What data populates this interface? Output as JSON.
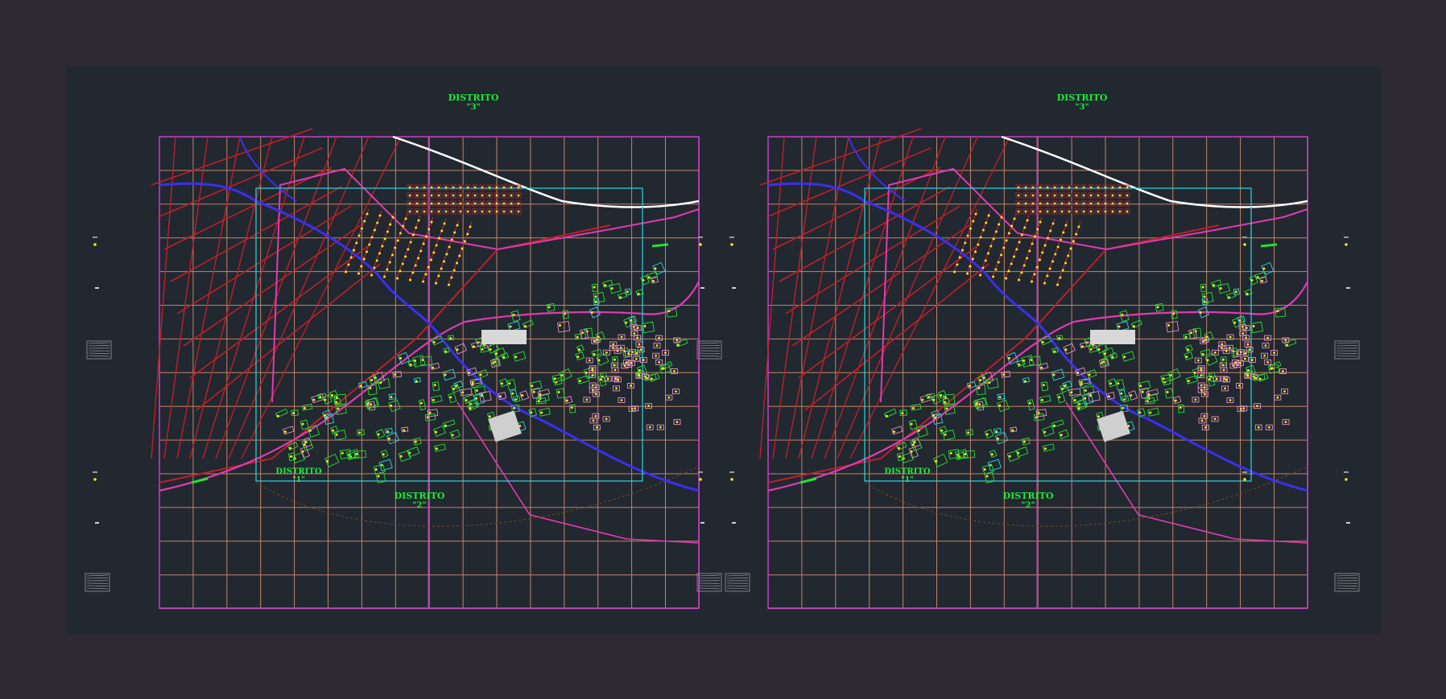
{
  "colors": {
    "background": "#2e2a31",
    "sheet": "#212830",
    "grid": "#c4846a",
    "frame": "#c03cc0",
    "road_red": "#c01f2a",
    "road_magenta": "#e23ab0",
    "river": "#3a2ff0",
    "lots_green": "#26e030",
    "lots_cyan": "#2ad8e0",
    "dots_yellow": "#f2e81a",
    "parcels_pink": "#e890c8",
    "district_label": "#22e83a",
    "highway": "#ffffff"
  },
  "sheets": [
    {
      "name": "left",
      "title_line1": "DISTRITO",
      "title_line2": "\"3\"",
      "bottom_line1": "DISTRITO",
      "bottom_line2": "\"2\"",
      "small_line1": "DISTRITO",
      "small_line2": "\"1\""
    },
    {
      "name": "right",
      "title_line1": "DISTRITO",
      "title_line2": "\"3\"",
      "bottom_line1": "DISTRITO",
      "bottom_line2": "\"2\"",
      "small_line1": "DISTRITO",
      "small_line2": "\"1\""
    }
  ]
}
